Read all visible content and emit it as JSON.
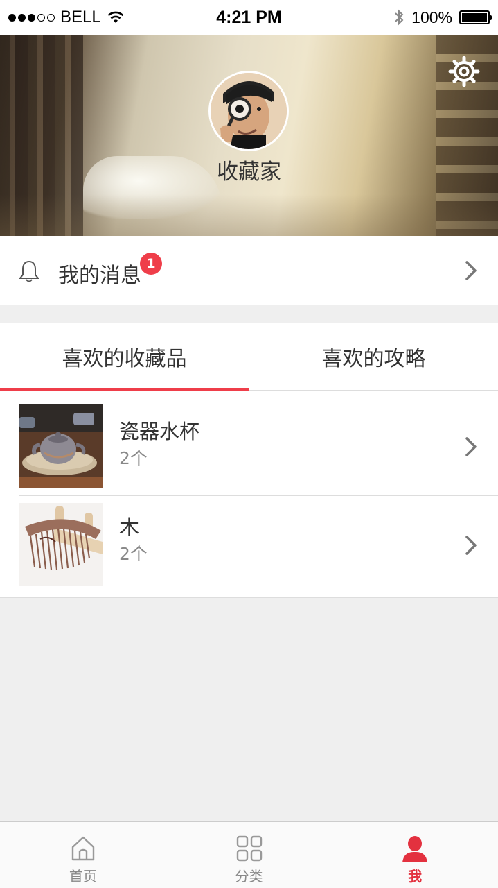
{
  "status_bar": {
    "carrier": "BELL",
    "time": "4:21 PM",
    "battery": "100%",
    "signal_bars_filled": 3,
    "signal_bars_total": 5
  },
  "profile": {
    "username": "收藏家",
    "settings_icon": "gear-icon",
    "avatar_icon": "avatar"
  },
  "messages": {
    "label": "我的消息",
    "badge": "1",
    "icon": "bell-icon"
  },
  "tabs": [
    {
      "label": "喜欢的收藏品",
      "active": true
    },
    {
      "label": "喜欢的攻略",
      "active": false
    }
  ],
  "favorites": [
    {
      "title": "瓷器水杯",
      "count": "2个"
    },
    {
      "title": "木",
      "count": "2个"
    }
  ],
  "tabbar": [
    {
      "label": "首页",
      "icon": "home-icon",
      "active": false
    },
    {
      "label": "分类",
      "icon": "grid-icon",
      "active": false
    },
    {
      "label": "我",
      "icon": "user-icon",
      "active": true
    }
  ],
  "colors": {
    "accent": "#ef3e4a",
    "tabbar_active": "#e3313f"
  }
}
